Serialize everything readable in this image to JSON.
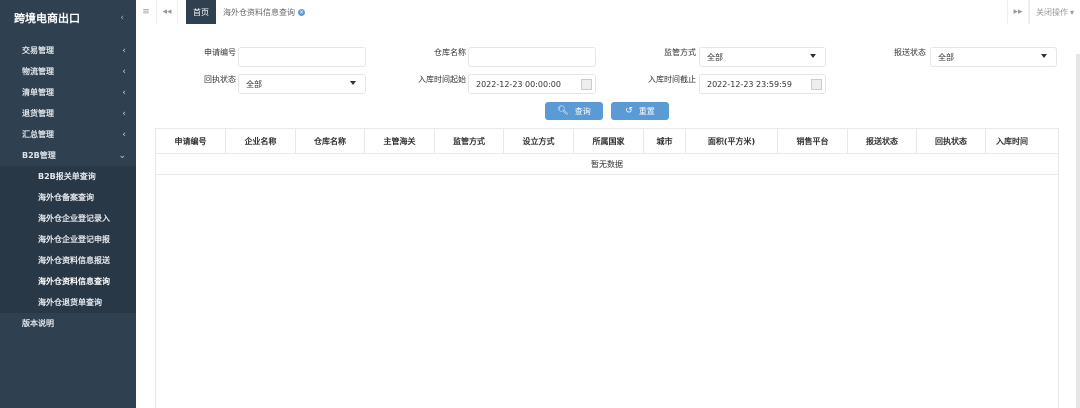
{
  "sidebar": {
    "app_title": "跨境电商出口",
    "menu": [
      {
        "label": "交易管理"
      },
      {
        "label": "物流管理"
      },
      {
        "label": "清单管理"
      },
      {
        "label": "退货管理"
      },
      {
        "label": "汇总管理"
      }
    ],
    "b2b": {
      "label": "B2B管理",
      "items": [
        {
          "label": "B2B报关单查询"
        },
        {
          "label": "海外仓备案查询"
        },
        {
          "label": "海外仓企业登记录入"
        },
        {
          "label": "海外仓企业登记申报"
        },
        {
          "label": "海外仓资料信息报送"
        },
        {
          "label": "海外仓资料信息查询"
        },
        {
          "label": "海外仓退货单查询"
        }
      ]
    },
    "version": {
      "label": "版本说明"
    }
  },
  "tabbar": {
    "home": "首页",
    "current": "海外仓资料信息查询",
    "close_ops": "关闭操作"
  },
  "form": {
    "apply_no": {
      "label": "申请编号",
      "value": ""
    },
    "warehouse_name": {
      "label": "仓库名称",
      "value": ""
    },
    "supervision": {
      "label": "监管方式",
      "value": "全部"
    },
    "report_status": {
      "label": "报送状态",
      "value": "全部"
    },
    "receipt_status": {
      "label": "回执状态",
      "value": "全部"
    },
    "in_time_start": {
      "label": "入库时间起始",
      "value": "2022-12-23 00:00:00"
    },
    "in_time_end": {
      "label": "入库时间截止",
      "value": "2022-12-23 23:59:59"
    },
    "search_label": "查询",
    "reset_label": "重置"
  },
  "table": {
    "columns": [
      "申请编号",
      "企业名称",
      "仓库名称",
      "主管海关",
      "监管方式",
      "设立方式",
      "所属国家",
      "城市",
      "面积(平方米)",
      "销售平台",
      "报送状态",
      "回执状态",
      "入库时间"
    ],
    "empty_text": "暂无数据"
  },
  "colors": {
    "sidebar_bg": "#2f4050",
    "primary_button": "#5b9bd5"
  }
}
